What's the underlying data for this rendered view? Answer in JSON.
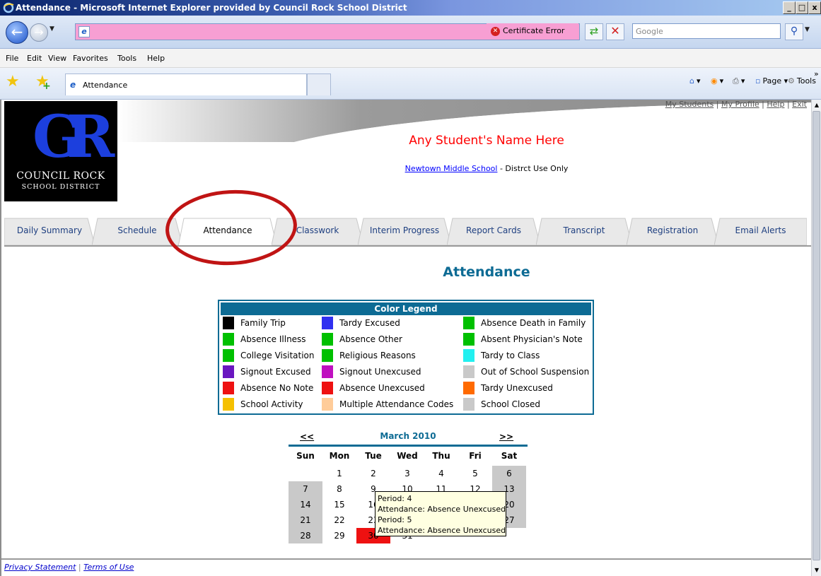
{
  "window": {
    "title": "Attendance - Microsoft Internet Explorer provided by Council Rock School District",
    "controls": [
      "_",
      "□",
      "x"
    ]
  },
  "addressbar": {
    "url": "",
    "cert_error": "Certificate Error",
    "search_placeholder": "Google"
  },
  "menu": [
    "File",
    "Edit",
    "View",
    "Favorites",
    "Tools",
    "Help"
  ],
  "favbar": {
    "tab_label": "Attendance",
    "page_label": "Page",
    "tools_label": "Tools",
    "more": "»"
  },
  "header": {
    "top_links": [
      "My Students",
      "My Profile",
      "Help",
      "Exit"
    ],
    "logo_line1": "COUNCIL ROCK",
    "logo_line2": "SCHOOL DISTRICT",
    "logo_mark": "GR",
    "student_name": "Any Student's Name Here",
    "school_link": "Newtown Middle School",
    "school_suffix": " - Distrct Use Only"
  },
  "tabs": [
    {
      "label": "Daily Summary"
    },
    {
      "label": "Schedule"
    },
    {
      "label": "Attendance"
    },
    {
      "label": "Classwork"
    },
    {
      "label": "Interim Progress"
    },
    {
      "label": "Report Cards"
    },
    {
      "label": "Transcript"
    },
    {
      "label": "Registration"
    },
    {
      "label": "Email Alerts"
    }
  ],
  "active_tab": "Attendance",
  "page_title": "Attendance",
  "legend": {
    "title": "Color Legend",
    "col1": [
      {
        "label": "Family Trip",
        "color": "#000000"
      },
      {
        "label": "Absence Illness",
        "color": "#00c000"
      },
      {
        "label": "College Visitation",
        "color": "#00c000"
      },
      {
        "label": "Signout Excused",
        "color": "#6a16c0"
      },
      {
        "label": "Absence No Note",
        "color": "#ee1111"
      },
      {
        "label": "School Activity",
        "color": "#f5c000"
      }
    ],
    "col2": [
      {
        "label": "Tardy Excused",
        "color": "#3030f0"
      },
      {
        "label": "Absence Other",
        "color": "#00c000"
      },
      {
        "label": "Religious Reasons",
        "color": "#00c000"
      },
      {
        "label": "Signout Unexcused",
        "color": "#c010c0"
      },
      {
        "label": "Absence Unexcused",
        "color": "#ee1111"
      },
      {
        "label": "Multiple Attendance Codes",
        "color": "#ffcc99"
      }
    ],
    "col3": [
      {
        "label": "Absence Death in Family",
        "color": "#00c000"
      },
      {
        "label": "Absent Physician's Note",
        "color": "#00c000"
      },
      {
        "label": "Tardy to Class",
        "color": "#22f0f0"
      },
      {
        "label": "Out of School Suspension",
        "color": "#c9c9c9"
      },
      {
        "label": "Tardy Unexcused",
        "color": "#ff6a00"
      },
      {
        "label": "School Closed",
        "color": "#c9c9c9"
      }
    ]
  },
  "calendar": {
    "prev": "<<",
    "next": ">>",
    "month": "March 2010",
    "days": [
      "Sun",
      "Mon",
      "Tue",
      "Wed",
      "Thu",
      "Fri",
      "Sat"
    ],
    "first_weekday": 1,
    "num_days": 31,
    "highlighted": {
      "30": "Absence Unexcused"
    }
  },
  "tooltip": {
    "line1": "Period: 4",
    "line2": "Attendance: Absence Unexcused",
    "line3": "Period: 5",
    "line4": "Attendance: Absence Unexcused"
  },
  "footer": {
    "privacy": "Privacy Statement",
    "separator": " | ",
    "terms": "Terms of Use"
  }
}
